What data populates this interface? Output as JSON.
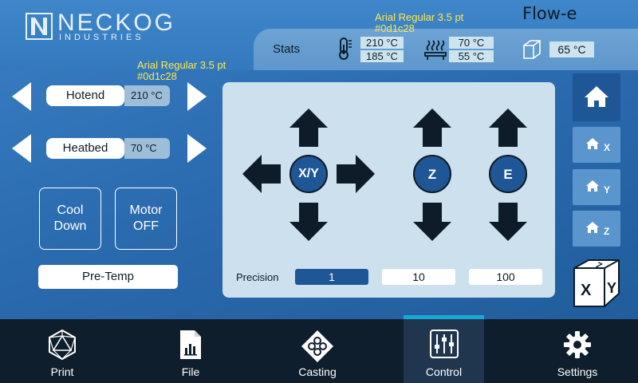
{
  "header": {
    "logo_title": "NECKOG",
    "logo_subtitle": "INDUSTRIES",
    "brand": "Flow-e",
    "annotation_top": {
      "line1": "Arial Regular 3.5 pt",
      "line2": "#0d1c28"
    },
    "annotation_left": {
      "line1": "Arial Regular 3.5 pt",
      "line2": "#0d1c28"
    }
  },
  "stats": {
    "label": "Stats",
    "hotend_icon": "thermometer-icon",
    "hotend_current": "210 °C",
    "hotend_target": "185 °C",
    "bed_icon": "heatbed-icon",
    "bed_current": "70 °C",
    "bed_target": "55 °C",
    "chamber_icon": "cube-icon",
    "chamber_temp": "65 °C"
  },
  "temperature": {
    "hotend_label": "Hotend",
    "hotend_value": "210 °C",
    "heatbed_label": "Heatbed",
    "heatbed_value": "70 °C"
  },
  "buttons": {
    "cooldown_line1": "Cool",
    "cooldown_line2": "Down",
    "motoroff_line1": "Motor",
    "motoroff_line2": "OFF",
    "pretemp": "Pre-Temp"
  },
  "jog": {
    "xy_label": "X/Y",
    "z_label": "Z",
    "e_label": "E",
    "precision_label": "Precision",
    "precision_options": [
      "1",
      "10",
      "100"
    ],
    "precision_selected": "1"
  },
  "home": {
    "all_icon": "home-icon",
    "x_label": "X",
    "y_label": "Y",
    "z_label": "Z",
    "cube_labels": [
      "Z",
      "X",
      "Y"
    ]
  },
  "nav": {
    "items": [
      {
        "label": "Print",
        "icon": "d20-icon"
      },
      {
        "label": "File",
        "icon": "file-chart-icon"
      },
      {
        "label": "Casting",
        "icon": "casting-icon"
      },
      {
        "label": "Control",
        "icon": "sliders-icon"
      },
      {
        "label": "Settings",
        "icon": "gear-icon"
      }
    ],
    "active": "Control"
  },
  "colors": {
    "text_dark": "#0d1c28",
    "accent_dark_blue": "#1f5696",
    "nav_bg": "#0f1e2d",
    "nav_indicator": "#17a9d6",
    "annotation": "#ffe94a"
  }
}
